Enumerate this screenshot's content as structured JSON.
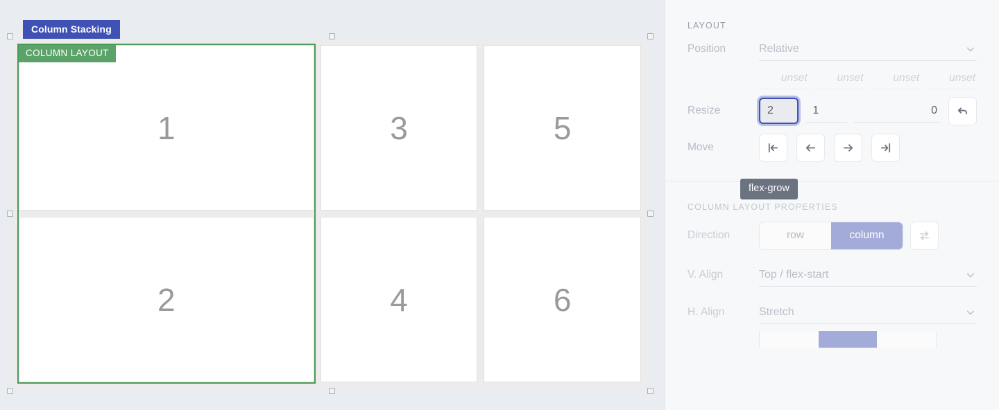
{
  "canvas": {
    "title_tag": "Column Stacking",
    "selected_element_tag": "COLUMN LAYOUT",
    "cells": [
      {
        "label": "1",
        "column": 1
      },
      {
        "label": "2",
        "column": 1
      },
      {
        "label": "3",
        "column": 2
      },
      {
        "label": "4",
        "column": 2
      },
      {
        "label": "5",
        "column": 3
      },
      {
        "label": "6",
        "column": 3
      }
    ],
    "colors": {
      "title_tag_bg": "#3f51b5",
      "selection_tag_bg": "#5ba368",
      "selection_outline": "#4c9a57",
      "canvas_bg": "#e9ecf1",
      "frame_bg": "#ececec",
      "cell_bg": "#ffffff",
      "cell_number": "#9a9a9a"
    }
  },
  "panel": {
    "layout_section": {
      "title": "LAYOUT",
      "position": {
        "label": "Position",
        "value": "Relative",
        "chevron": "chevron-down-icon"
      },
      "offsets": [
        {
          "placeholder": "unset",
          "value": "unset"
        },
        {
          "placeholder": "unset",
          "value": "unset"
        },
        {
          "placeholder": "unset",
          "value": "unset"
        },
        {
          "placeholder": "unset",
          "value": "unset"
        }
      ],
      "resize": {
        "label": "Resize",
        "flex_grow": "2",
        "flex_shrink": "1",
        "flex_basis": "0",
        "reset_icon": "undo-arrow-icon"
      },
      "move": {
        "label": "Move",
        "buttons": [
          {
            "icon": "move-first-icon",
            "label": ""
          },
          {
            "icon": "move-left-icon",
            "label": ""
          },
          {
            "icon": "move-right-icon",
            "label": "→"
          },
          {
            "icon": "move-last-icon",
            "label": "→|"
          }
        ]
      }
    },
    "tooltip": {
      "text": "flex-grow"
    },
    "column_layout_section": {
      "title": "COLUMN LAYOUT PROPERTIES",
      "direction": {
        "label": "Direction",
        "options": [
          "row",
          "column"
        ],
        "selected": "column",
        "swap_icon": "swap-horizontal-icon"
      },
      "v_align": {
        "label": "V. Align",
        "value": "Top / flex-start",
        "chevron": "chevron-down-icon"
      },
      "h_align": {
        "label": "H. Align",
        "value": "Stretch",
        "chevron": "chevron-down-icon"
      },
      "wrap": {
        "options": [
          "",
          "",
          ""
        ],
        "selected_index": 1
      }
    },
    "colors": {
      "panel_bg": "#f7f8fa",
      "accent": "#a3abd9",
      "focus_ring": "#3f51b5",
      "tooltip_bg": "#6b7280"
    }
  }
}
